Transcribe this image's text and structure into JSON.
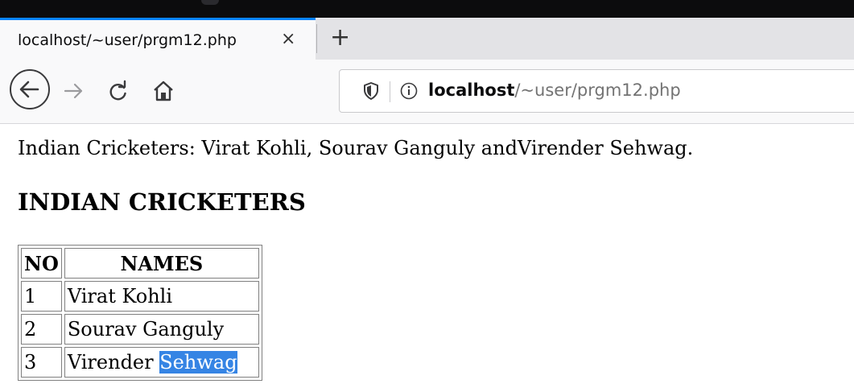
{
  "tab": {
    "title": "localhost/~user/prgm12.php",
    "close": "×",
    "new_tab": "+"
  },
  "nav": {
    "url_host": "localhost",
    "url_path": "/~user/prgm12.php"
  },
  "icons": {
    "back": "back-arrow-icon",
    "forward": "forward-arrow-icon",
    "reload": "reload-icon",
    "home": "home-icon",
    "shield": "shield-icon",
    "info": "info-icon"
  },
  "page": {
    "paragraph": "Indian Cricketers: Virat Kohli, Sourav Ganguly andVirender Sehwag.",
    "heading": "INDIAN CRICKETERS",
    "table": {
      "headers": [
        "NO",
        "NAMES"
      ],
      "rows": [
        {
          "no": "1",
          "name": "Virat Kohli"
        },
        {
          "no": "2",
          "name": "Sourav Ganguly"
        },
        {
          "no": "3",
          "name_first": "Virender ",
          "name_selected": "Sehwag"
        }
      ]
    }
  },
  "colors": {
    "accent": "#0a84ff",
    "selection": "#3584e4"
  }
}
